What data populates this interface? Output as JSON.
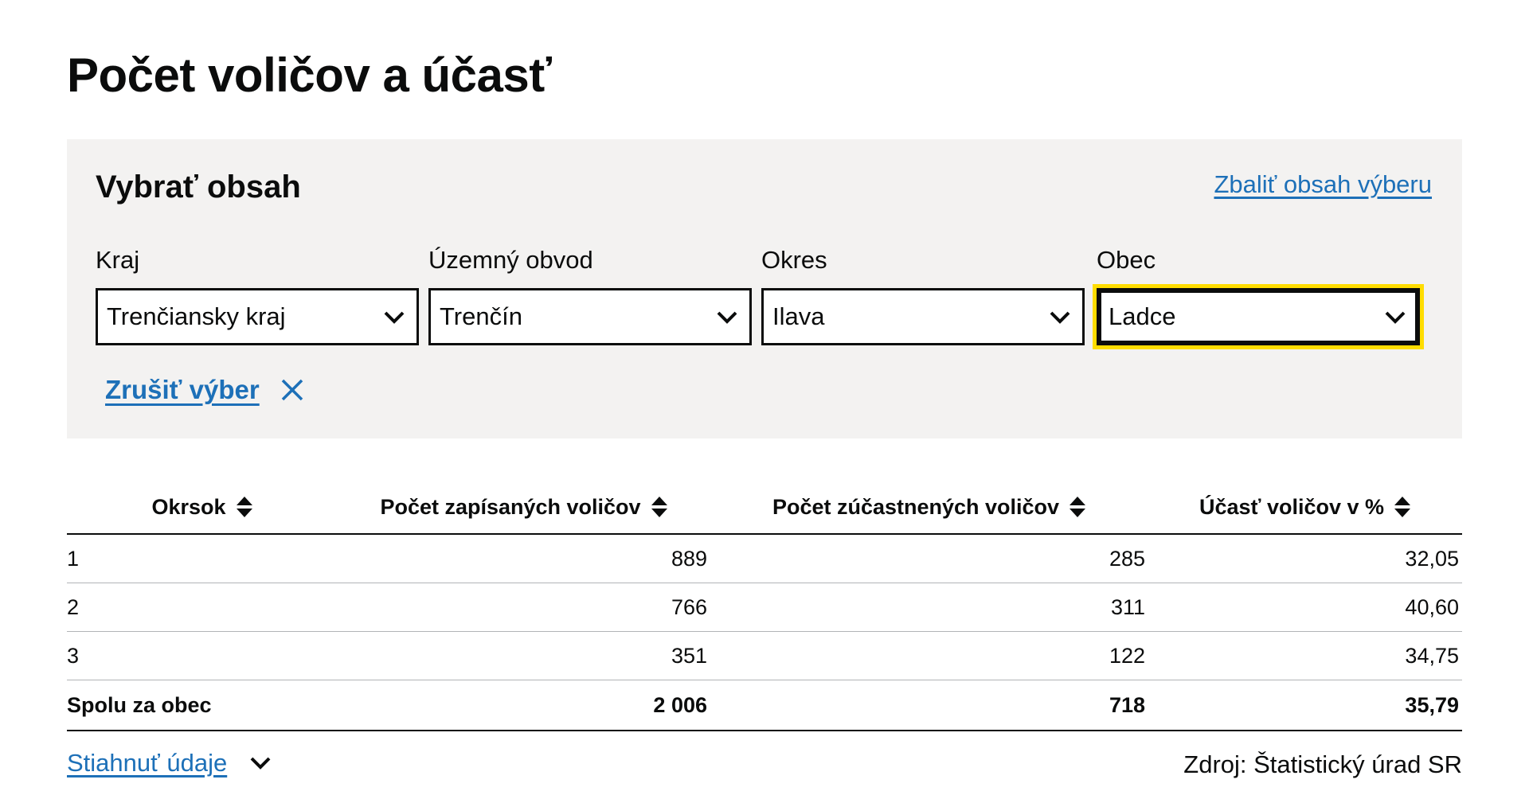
{
  "page": {
    "title": "Počet voličov a účasť"
  },
  "filter": {
    "title": "Vybrať obsah",
    "collapse_label": "Zbaliť obsah výberu",
    "fields": [
      {
        "label": "Kraj",
        "value": "Trenčiansky kraj"
      },
      {
        "label": "Územný obvod",
        "value": "Trenčín"
      },
      {
        "label": "Okres",
        "value": "Ilava"
      },
      {
        "label": "Obec",
        "value": "Ladce"
      }
    ],
    "clear_label": "Zrušiť výber"
  },
  "table": {
    "columns": [
      "Okrsok",
      "Počet zapísaných voličov",
      "Počet zúčastnených voličov",
      "Účasť voličov v %"
    ],
    "rows": [
      [
        "1",
        "889",
        "285",
        "32,05"
      ],
      [
        "2",
        "766",
        "311",
        "40,60"
      ],
      [
        "3",
        "351",
        "122",
        "34,75"
      ]
    ],
    "total": [
      "Spolu za obec",
      "2 006",
      "718",
      "35,79"
    ]
  },
  "footer": {
    "download_label": "Stiahnuť údaje",
    "source": "Zdroj: Štatistický úrad SR"
  },
  "colors": {
    "link": "#1d70b8",
    "focus": "#ffdd00",
    "panel": "#f3f2f1"
  },
  "icons": {
    "select_chevron": "chevron-down-icon",
    "clear": "close-icon",
    "sort": "sort-icon",
    "download": "chevron-down-icon"
  }
}
